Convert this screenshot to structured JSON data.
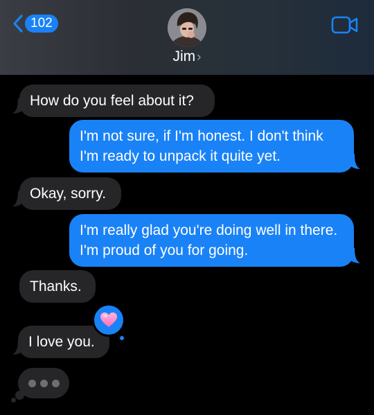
{
  "header": {
    "back_count": "102",
    "contact_name": "Jim",
    "chevron": "›"
  },
  "messages": [
    {
      "direction": "incoming",
      "text": "How do you feel about it?"
    },
    {
      "direction": "outgoing",
      "text": "I'm not sure, if I'm honest. I don't think I'm ready to unpack it quite yet."
    },
    {
      "direction": "incoming",
      "text": "Okay, sorry."
    },
    {
      "direction": "outgoing",
      "text": "I'm really glad you're doing well in there. I'm proud of you for going."
    },
    {
      "direction": "incoming",
      "text": "Thanks."
    },
    {
      "direction": "incoming",
      "text": "I love you.",
      "tapback": "heart-icon"
    }
  ],
  "typing_indicator": true,
  "colors": {
    "outgoing_bubble": "#1a82f7",
    "incoming_bubble": "#262628",
    "tapback_heart": "#ff8fc7"
  },
  "icons": {
    "back": "chevron-left-icon",
    "video": "video-camera-icon",
    "tapback": "heart-icon"
  }
}
